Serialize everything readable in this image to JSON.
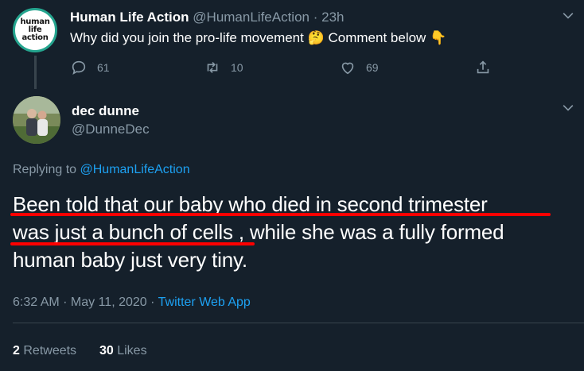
{
  "parent_tweet": {
    "avatar_text": [
      "human",
      "life",
      "action"
    ],
    "name": "Human Life Action",
    "handle": "@HumanLifeAction",
    "dot": "·",
    "time": "23h",
    "text_before": "Why did you join the pro-life movement",
    "emoji_thinking": "🤔",
    "text_middle": "Comment below",
    "emoji_pointing": "👇",
    "replies": "61",
    "retweets": "10",
    "likes": "69"
  },
  "main_tweet": {
    "name": "dec dunne",
    "handle": "@DunneDec",
    "replying_prefix": "Replying to",
    "replying_to": "@HumanLifeAction",
    "line1": "Been told that our baby who died in second trimester",
    "line2_underlined": "was just a bunch of cells",
    "line2_rest": ", while she was a fully formed",
    "line3": "human baby just very tiny.",
    "timestamp": "6:32 AM · May 11, 2020 ·",
    "app": "Twitter Web App",
    "retweet_count": "2",
    "retweet_label": "Retweets",
    "like_count": "30",
    "like_label": "Likes"
  },
  "icons": [
    "reply-icon",
    "retweet-icon",
    "like-icon",
    "share-icon",
    "chevron-down-icon"
  ],
  "colors": {
    "background": "#15202b",
    "secondary_text": "#8899a6",
    "link": "#1da1f2",
    "annotation_underline": "#ff0000",
    "brand_ring": "#25a58f"
  }
}
